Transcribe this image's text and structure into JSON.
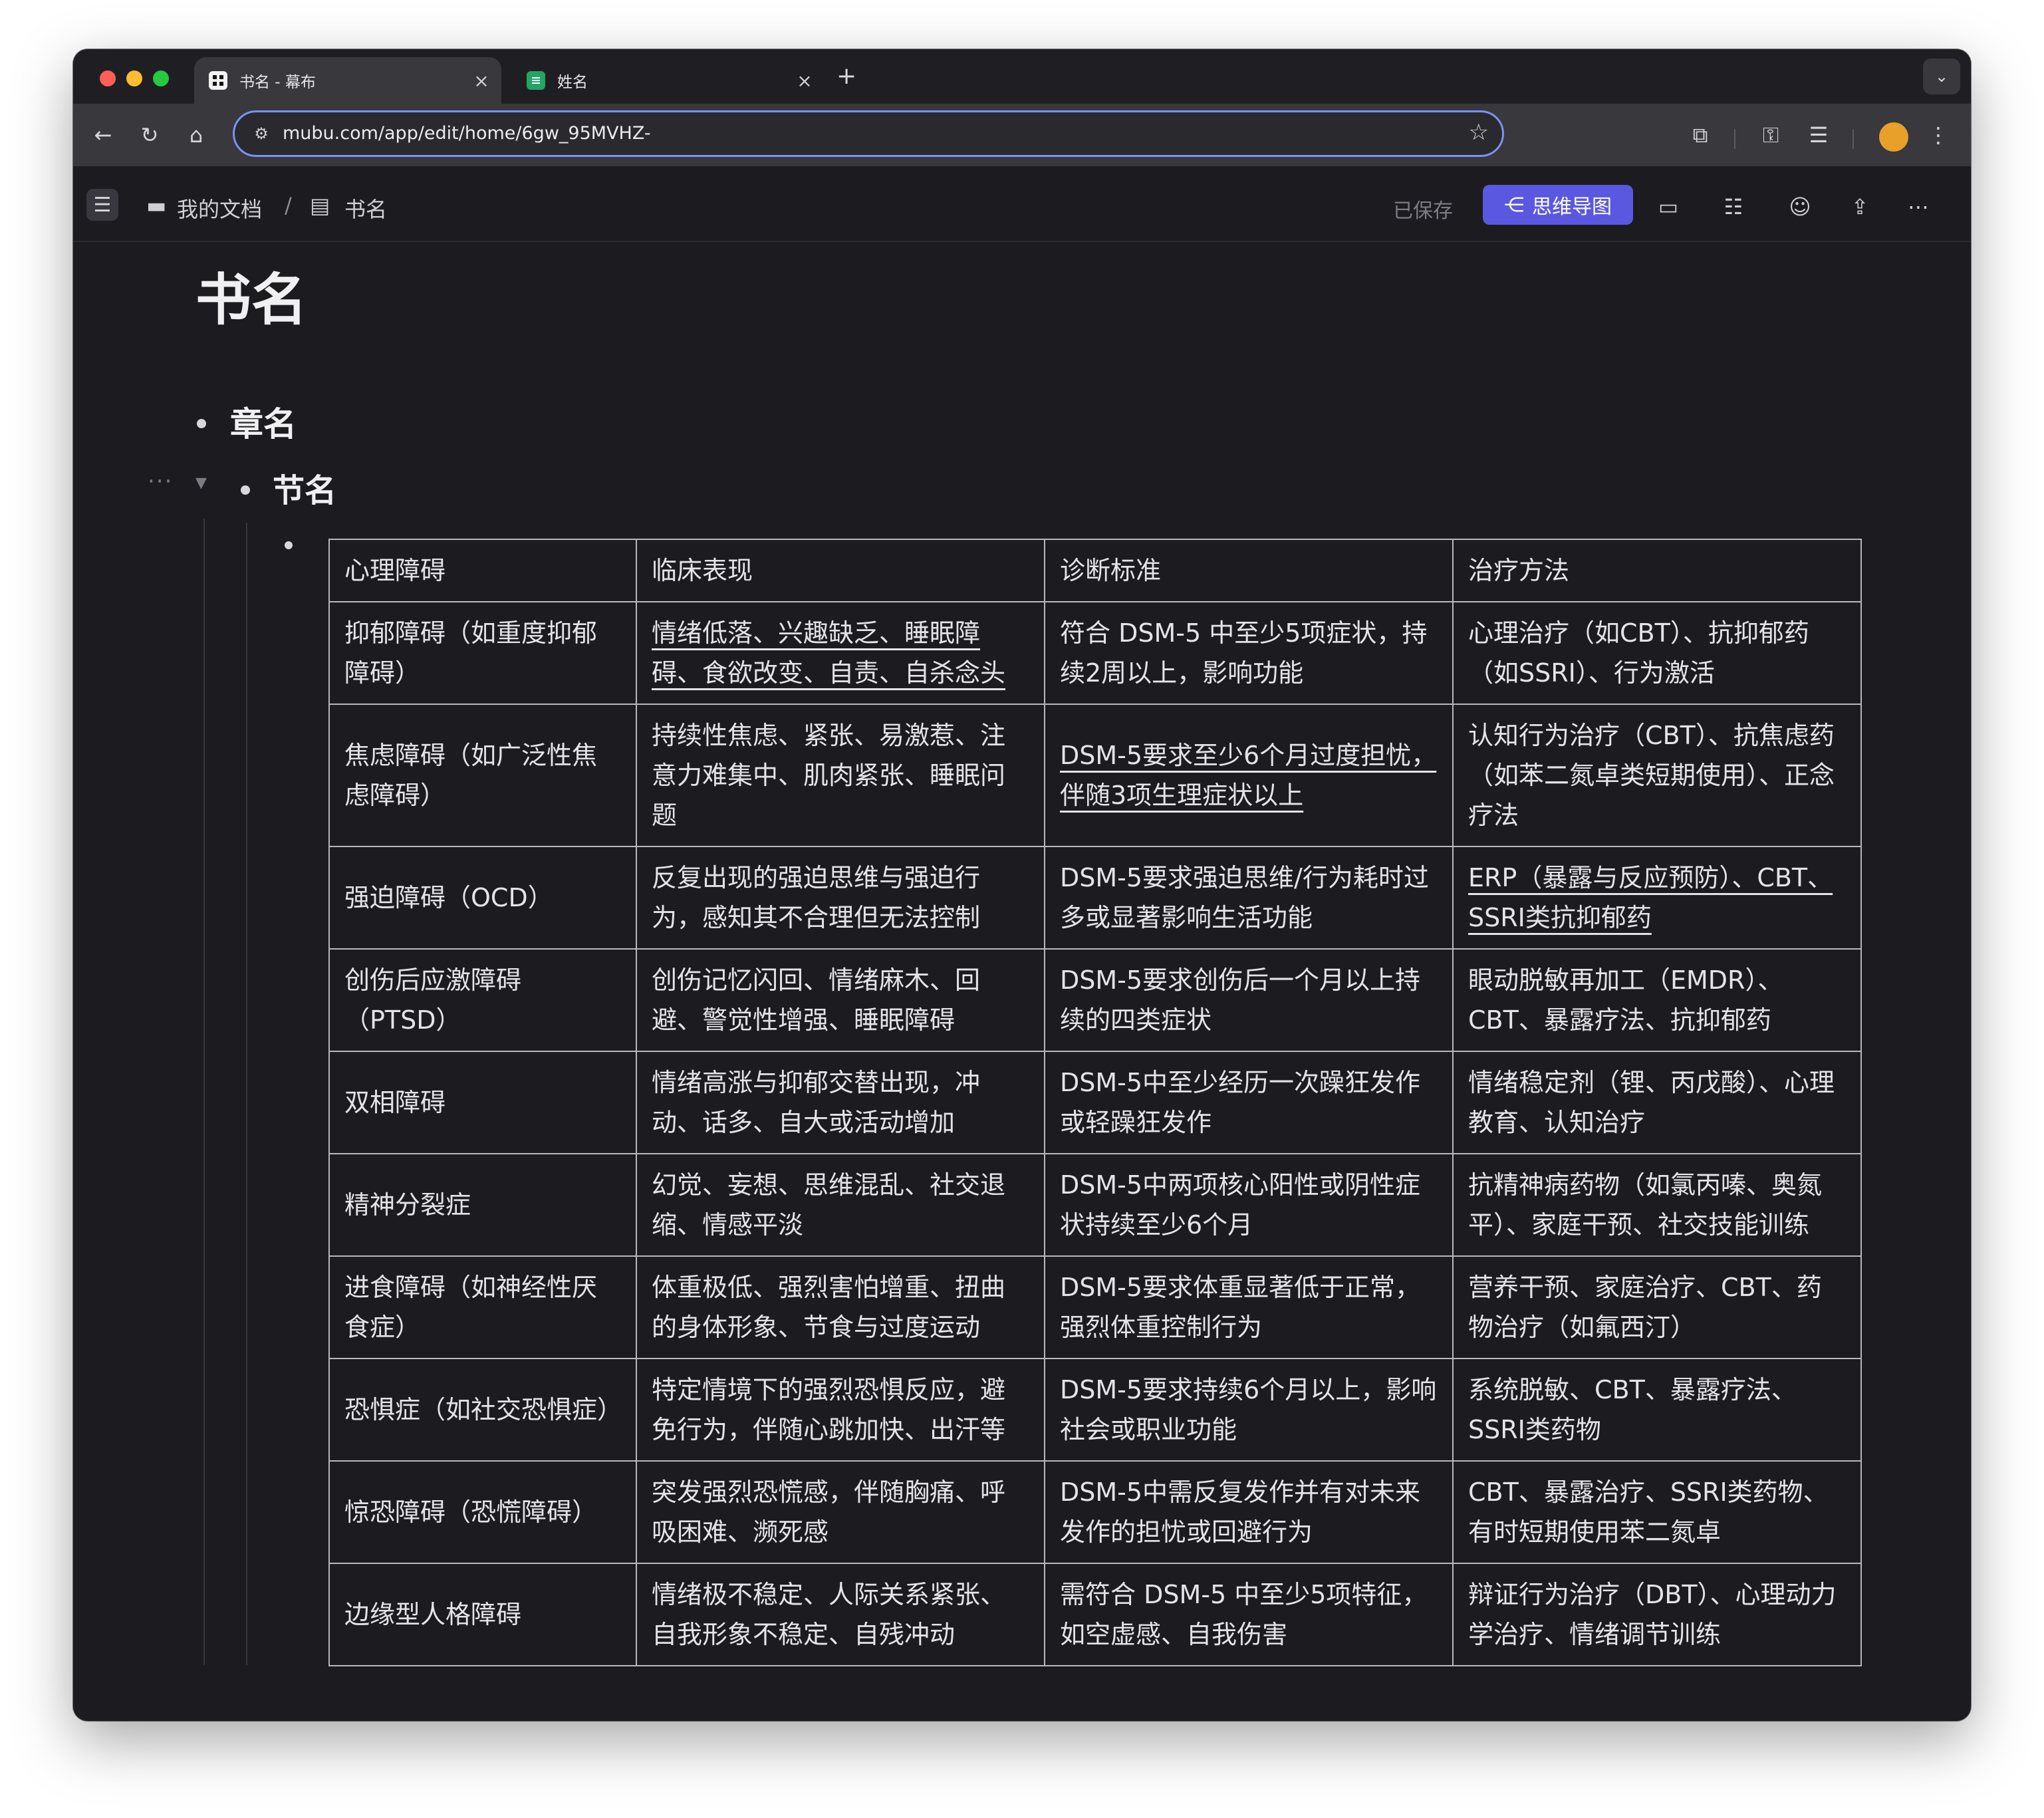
{
  "browser": {
    "tabs": [
      {
        "title": "书名 - 幕布",
        "active": true
      },
      {
        "title": "姓名",
        "active": false
      }
    ],
    "url": "mubu.com/app/edit/home/6gw_95MVHZ-"
  },
  "app_header": {
    "breadcrumb_root": "我的文档",
    "breadcrumb_sep": "/",
    "breadcrumb_doc": "书名",
    "saved_status": "已保存",
    "mindmap_button": "思维导图"
  },
  "doc": {
    "title": "书名",
    "chapter": "章名",
    "section": "节名"
  },
  "table": {
    "headers": [
      "心理障碍",
      "临床表现",
      "诊断标准",
      "治疗方法"
    ],
    "rows": [
      [
        "抑郁障碍（如重度抑郁障碍）",
        "情绪低落、兴趣缺乏、睡眠障碍、食欲改变、自责、自杀念头",
        "符合 DSM-5 中至少5项症状，持续2周以上，影响功能",
        "心理治疗（如CBT）、抗抑郁药（如SSRI）、行为激活"
      ],
      [
        "焦虑障碍（如广泛性焦虑障碍）",
        "持续性焦虑、紧张、易激惹、注意力难集中、肌肉紧张、睡眠问题",
        "DSM-5要求至少6个月过度担忧，伴随3项生理症状以上",
        "认知行为治疗（CBT）、抗焦虑药（如苯二氮卓类短期使用）、正念疗法"
      ],
      [
        "强迫障碍（OCD）",
        "反复出现的强迫思维与强迫行为，感知其不合理但无法控制",
        "DSM-5要求强迫思维/行为耗时过多或显著影响生活功能",
        "ERP（暴露与反应预防）、CBT、SSRI类抗抑郁药"
      ],
      [
        "创伤后应激障碍（PTSD）",
        "创伤记忆闪回、情绪麻木、回避、警觉性增强、睡眠障碍",
        "DSM-5要求创伤后一个月以上持续的四类症状",
        "眼动脱敏再加工（EMDR）、CBT、暴露疗法、抗抑郁药"
      ],
      [
        "双相障碍",
        "情绪高涨与抑郁交替出现，冲动、话多、自大或活动增加",
        "DSM-5中至少经历一次躁狂发作或轻躁狂发作",
        "情绪稳定剂（锂、丙戊酸）、心理教育、认知治疗"
      ],
      [
        "精神分裂症",
        "幻觉、妄想、思维混乱、社交退缩、情感平淡",
        "DSM-5中两项核心阳性或阴性症状持续至少6个月",
        "抗精神病药物（如氯丙嗪、奥氮平）、家庭干预、社交技能训练"
      ],
      [
        "进食障碍（如神经性厌食症）",
        "体重极低、强烈害怕增重、扭曲的身体形象、节食与过度运动",
        "DSM-5要求体重显著低于正常，强烈体重控制行为",
        "营养干预、家庭治疗、CBT、药物治疗（如氟西汀）"
      ],
      [
        "恐惧症（如社交恐惧症）",
        "特定情境下的强烈恐惧反应，避免行为，伴随心跳加快、出汗等",
        "DSM-5要求持续6个月以上，影响社会或职业功能",
        "系统脱敏、CBT、暴露疗法、SSRI类药物"
      ],
      [
        "惊恐障碍（恐慌障碍）",
        "突发强烈恐慌感，伴随胸痛、呼吸困难、濒死感",
        "DSM-5中需反复发作并有对未来发作的担忧或回避行为",
        "CBT、暴露治疗、SSRI类药物、有时短期使用苯二氮卓"
      ],
      [
        "边缘型人格障碍",
        "情绪极不稳定、人际关系紧张、自我形象不稳定、自残冲动",
        "需符合 DSM-5 中至少5项特征，如空虚感、自我伤害",
        "辩证行为治疗（DBT）、心理动力学治疗、情绪调节训练"
      ]
    ]
  },
  "colors": {
    "window_bg": "#1c1b20",
    "toolbar_bg": "#38383d",
    "accent": "#5a58e0",
    "omnibox_border": "#7a93f5",
    "table_border": "#b8b8bd"
  },
  "icons": [
    "back-icon",
    "reload-icon",
    "home-icon",
    "tune-icon",
    "star-icon",
    "extensions-icon",
    "password-key-icon",
    "reading-list-icon",
    "more-vert-icon",
    "folder-icon",
    "doc-icon",
    "mindmap-icon",
    "presentation-icon",
    "search-doc-icon",
    "collaborator-icon",
    "share-icon",
    "more-icon"
  ]
}
